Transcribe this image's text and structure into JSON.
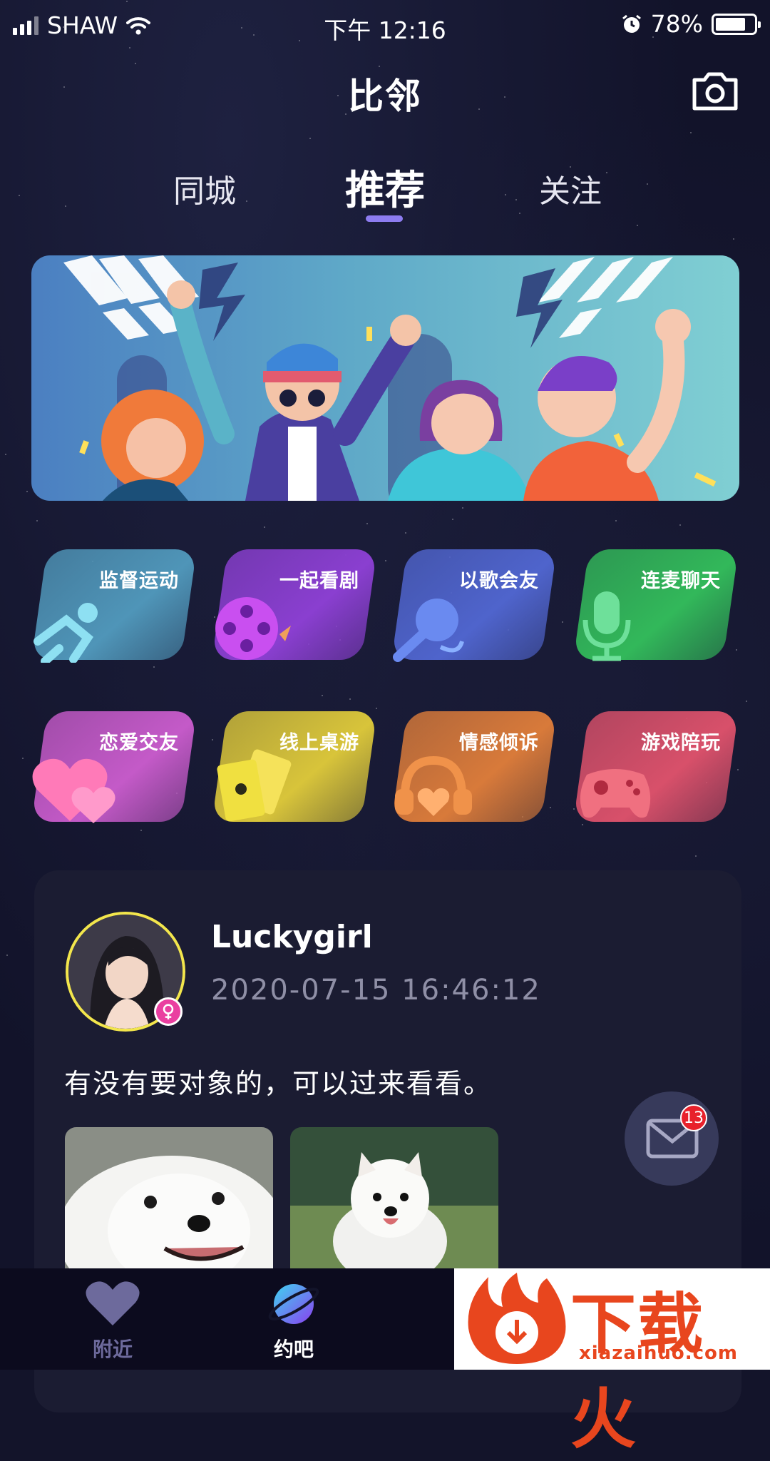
{
  "status_bar": {
    "carrier": "SHAW",
    "time": "下午 12:16",
    "battery_percent": "78%",
    "battery_level": 0.78
  },
  "header": {
    "title": "比邻",
    "camera_icon": "camera-icon"
  },
  "tabs": [
    {
      "label": "同城",
      "active": false
    },
    {
      "label": "推荐",
      "active": true
    },
    {
      "label": "关注",
      "active": false
    }
  ],
  "banner": {
    "image": "party-friends-illustration"
  },
  "categories": [
    {
      "label": "监督运动",
      "icon": "running-icon",
      "color": "#4f95b8"
    },
    {
      "label": "一起看剧",
      "icon": "film-reel-icon",
      "color": "#8a3fd0"
    },
    {
      "label": "以歌会友",
      "icon": "microphone-icon",
      "color": "#4f64cc"
    },
    {
      "label": "连麦聊天",
      "icon": "mic-stand-icon",
      "color": "#32b85a"
    },
    {
      "label": "恋爱交友",
      "icon": "hearts-icon",
      "color": "#c45ac8"
    },
    {
      "label": "线上桌游",
      "icon": "cards-icon",
      "color": "#d8c43a"
    },
    {
      "label": "情感倾诉",
      "icon": "heart-headphones-icon",
      "color": "#d87a3a"
    },
    {
      "label": "游戏陪玩",
      "icon": "gamepad-icon",
      "color": "#d8506a"
    }
  ],
  "post": {
    "username": "Luckygirl",
    "timestamp": "2020-07-15 16:46:12",
    "gender": "female",
    "content": "有没有要对象的，可以过来看看。",
    "photos": [
      "samoyed-dog-photo",
      "samoyed-puppy-photo"
    ]
  },
  "mail": {
    "icon": "mail-icon",
    "badge": "13"
  },
  "bottom_nav": [
    {
      "label": "附近",
      "icon": "heart-icon",
      "active": false
    },
    {
      "label": "约吧",
      "icon": "planet-icon",
      "active": true
    }
  ],
  "watermark": {
    "text": "下载火",
    "url": "xiazaihuo.com"
  },
  "colors": {
    "background": "#13142a",
    "tab_indicator": "#8d7cf0",
    "card": "#1b1c32",
    "badge": "#e8212b",
    "avatar_ring": "#f3e64c",
    "gender_badge": "#ea3fa0"
  }
}
